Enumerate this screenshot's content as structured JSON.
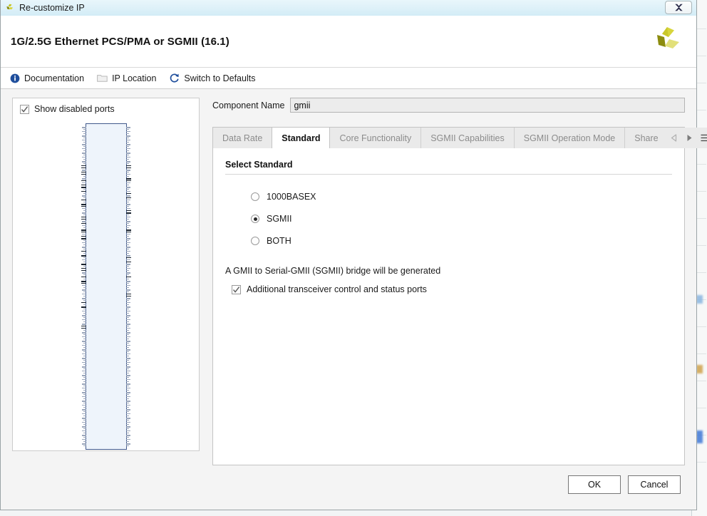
{
  "window": {
    "title": "Re-customize IP",
    "close_label": "Close",
    "app_icon": "xilinx-logo-icon"
  },
  "header": {
    "title": "1G/2.5G Ethernet PCS/PMA or SGMII (16.1)",
    "logo": "xilinx-logo-icon"
  },
  "toolbar": {
    "items": [
      {
        "label": "Documentation",
        "icon": "info-icon"
      },
      {
        "label": "IP Location",
        "icon": "folder-icon"
      },
      {
        "label": "Switch to Defaults",
        "icon": "refresh-icon"
      }
    ]
  },
  "left_panel": {
    "show_disabled_ports": {
      "label": "Show disabled ports",
      "checked": true
    },
    "ip_symbol": {
      "name": "ip-block-symbol",
      "fill_color": "#eef4fb",
      "border_color": "#41598c"
    }
  },
  "component": {
    "label": "Component Name",
    "value": "gmii",
    "placeholder": ""
  },
  "tabs": {
    "items": [
      {
        "label": "Data Rate",
        "active": false
      },
      {
        "label": "Standard",
        "active": true
      },
      {
        "label": "Core Functionality",
        "active": false
      },
      {
        "label": "SGMII Capabilities",
        "active": false
      },
      {
        "label": "SGMII Operation Mode",
        "active": false
      },
      {
        "label": "Share",
        "active": false
      }
    ],
    "controls": {
      "prev": "chevron-left-icon",
      "next": "chevron-right-icon",
      "menu": "hamburger-menu-icon"
    }
  },
  "standard_tab": {
    "section_title": "Select Standard",
    "options": [
      {
        "label": "1000BASEX",
        "selected": false
      },
      {
        "label": "SGMII",
        "selected": true
      },
      {
        "label": "BOTH",
        "selected": false
      }
    ],
    "note": "A GMII to Serial-GMII (SGMII) bridge will be generated",
    "extra_ports": {
      "label": "Additional transceiver control and status ports",
      "checked": true
    }
  },
  "footer": {
    "ok_label": "OK",
    "cancel_label": "Cancel"
  },
  "colors": {
    "titlebar_gradient_top": "#e9f6fb",
    "titlebar_gradient_bottom": "#d2ecf6",
    "accent_blue": "#1d4f91",
    "logo_yellow": "#c8c417",
    "logo_olive": "#9a9a12",
    "panel_bg": "#f4f4f4",
    "tab_inactive_text": "#8c8c8c"
  }
}
